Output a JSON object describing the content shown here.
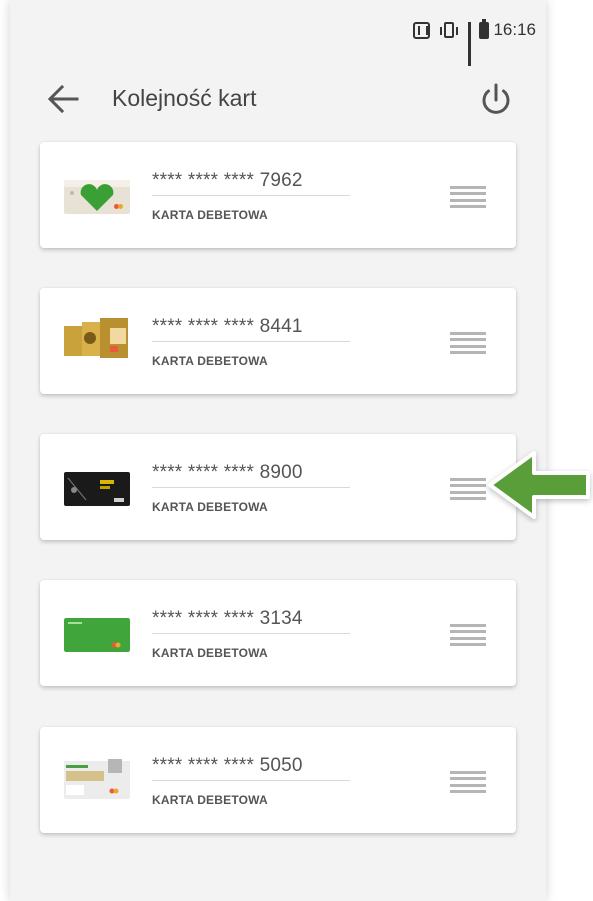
{
  "status_bar": {
    "time": "16:16",
    "icons": [
      "nfc-icon",
      "vibrate-icon",
      "signal-icon",
      "battery-icon"
    ]
  },
  "toolbar": {
    "back_icon": "arrow-left-icon",
    "title": "Kolejność kart",
    "power_icon": "power-icon"
  },
  "cards": [
    {
      "number": "**** **** **** 7962",
      "type": "KARTA DEBETOWA",
      "thumb": "white-card-green-heart"
    },
    {
      "number": "**** **** **** 8441",
      "type": "KARTA DEBETOWA",
      "thumb": "gold-cards"
    },
    {
      "number": "**** **** **** 8900",
      "type": "KARTA DEBETOWA",
      "thumb": "black-card"
    },
    {
      "number": "**** **** **** 3134",
      "type": "KARTA DEBETOWA",
      "thumb": "green-card"
    },
    {
      "number": "**** **** **** 5050",
      "type": "KARTA DEBETOWA",
      "thumb": "agro-card"
    }
  ],
  "annotation": {
    "icon": "green-arrow-left",
    "color": "#5a9e3a"
  },
  "colors": {
    "background": "#f3f3f3",
    "card": "#ffffff",
    "text": "#555555",
    "handle": "#b5b5b5"
  }
}
